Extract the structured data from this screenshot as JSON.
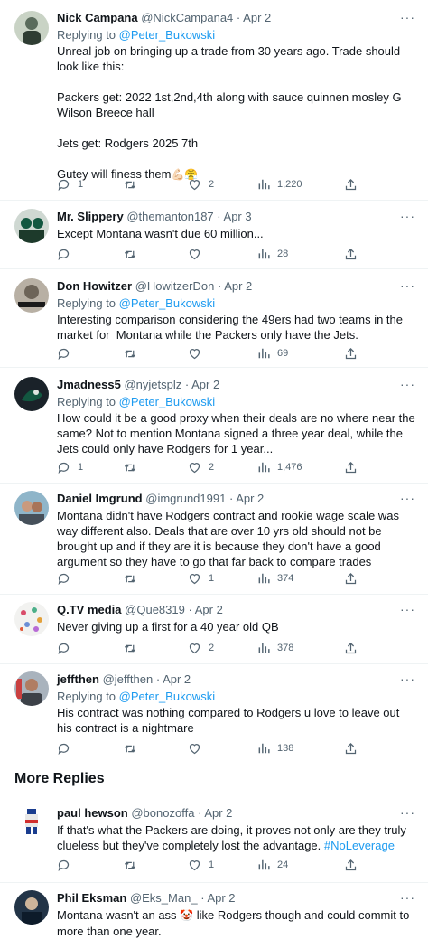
{
  "reply_prefix": "Replying to",
  "more_replies_title": "More Replies",
  "colors": {
    "link": "#1d9bf0",
    "muted": "#536471",
    "text": "#0f1419",
    "divider": "#eff3f4"
  },
  "tweets": [
    {
      "name": "Nick Campana",
      "handle": "@NickCampana4",
      "time": "Apr 2",
      "replying_to": "@Peter_Bukowski",
      "lines": [
        "Unreal job on bringing up a trade from 30 years ago. Trade should look like this:",
        "",
        "Packers get: 2022 1st,2nd,4th along with sauce quinnen mosley G Wilson Breece hall",
        "",
        "Jets get: Rodgers 2025 7th",
        "",
        "Gutey will finess them"
      ],
      "emoji": "💪🏻😤",
      "replies": "1",
      "retweets": "",
      "likes": "2",
      "views": "1,220"
    },
    {
      "name": "Mr. Slippery",
      "handle": "@themanton187",
      "time": "Apr 3",
      "lines": [
        "Except Montana wasn't due 60 million..."
      ],
      "replies": "",
      "retweets": "",
      "likes": "",
      "views": "28"
    },
    {
      "name": "Don Howitzer",
      "handle": "@HowitzerDon",
      "time": "Apr 2",
      "replying_to": "@Peter_Bukowski",
      "lines": [
        "Interesting comparison considering the 49ers had two teams in the market for  Montana while the Packers only have the Jets."
      ],
      "replies": "",
      "retweets": "",
      "likes": "",
      "views": "69"
    },
    {
      "name": "Jmadness5",
      "handle": "@nyjetsplz",
      "time": "Apr 2",
      "replying_to": "@Peter_Bukowski",
      "lines": [
        "How could it be a good proxy when their deals are no where near the same? Not to mention Montana signed a three year deal, while the Jets could only have Rodgers for 1 year..."
      ],
      "replies": "1",
      "retweets": "",
      "likes": "2",
      "views": "1,476"
    },
    {
      "name": "Daniel Imgrund",
      "handle": "@imgrund1991",
      "time": "Apr 2",
      "lines": [
        "Montana didn't have Rodgers contract and rookie wage scale was way different also. Deals that are over 10 yrs old should not be brought up and if they are it is because they don't have a good argument so they have to go that far back to compare trades"
      ],
      "replies": "",
      "retweets": "",
      "likes": "1",
      "views": "374"
    },
    {
      "name": "Q.TV media",
      "handle": "@Que8319",
      "time": "Apr 2",
      "lines": [
        "Never giving up a first for a 40 year old QB"
      ],
      "replies": "",
      "retweets": "",
      "likes": "2",
      "views": "378"
    },
    {
      "name": "jeffthen",
      "handle": "@jeffthen",
      "time": "Apr 2",
      "replying_to": "@Peter_Bukowski",
      "lines": [
        "His contract was nothing compared to Rodgers u love to leave out his contract is a nightmare"
      ],
      "replies": "",
      "retweets": "",
      "likes": "",
      "views": "138"
    },
    {
      "name": "paul hewson",
      "handle": "@bonozoffa",
      "time": "Apr 2",
      "lines": [
        "If that's what the Packers are doing, it proves not only are they truly clueless but they've completely lost the advantage. "
      ],
      "hashtag": "#NoLeverage",
      "replies": "",
      "retweets": "",
      "likes": "1",
      "views": "24"
    },
    {
      "name": "Phil Eksman",
      "handle": "@Eks_Man_",
      "time": "Apr 2",
      "text_before_emoji": "Montana wasn't an ass ",
      "emoji": "🤡",
      "text_after_emoji": " like Rodgers though and could commit to more than one year."
    }
  ]
}
